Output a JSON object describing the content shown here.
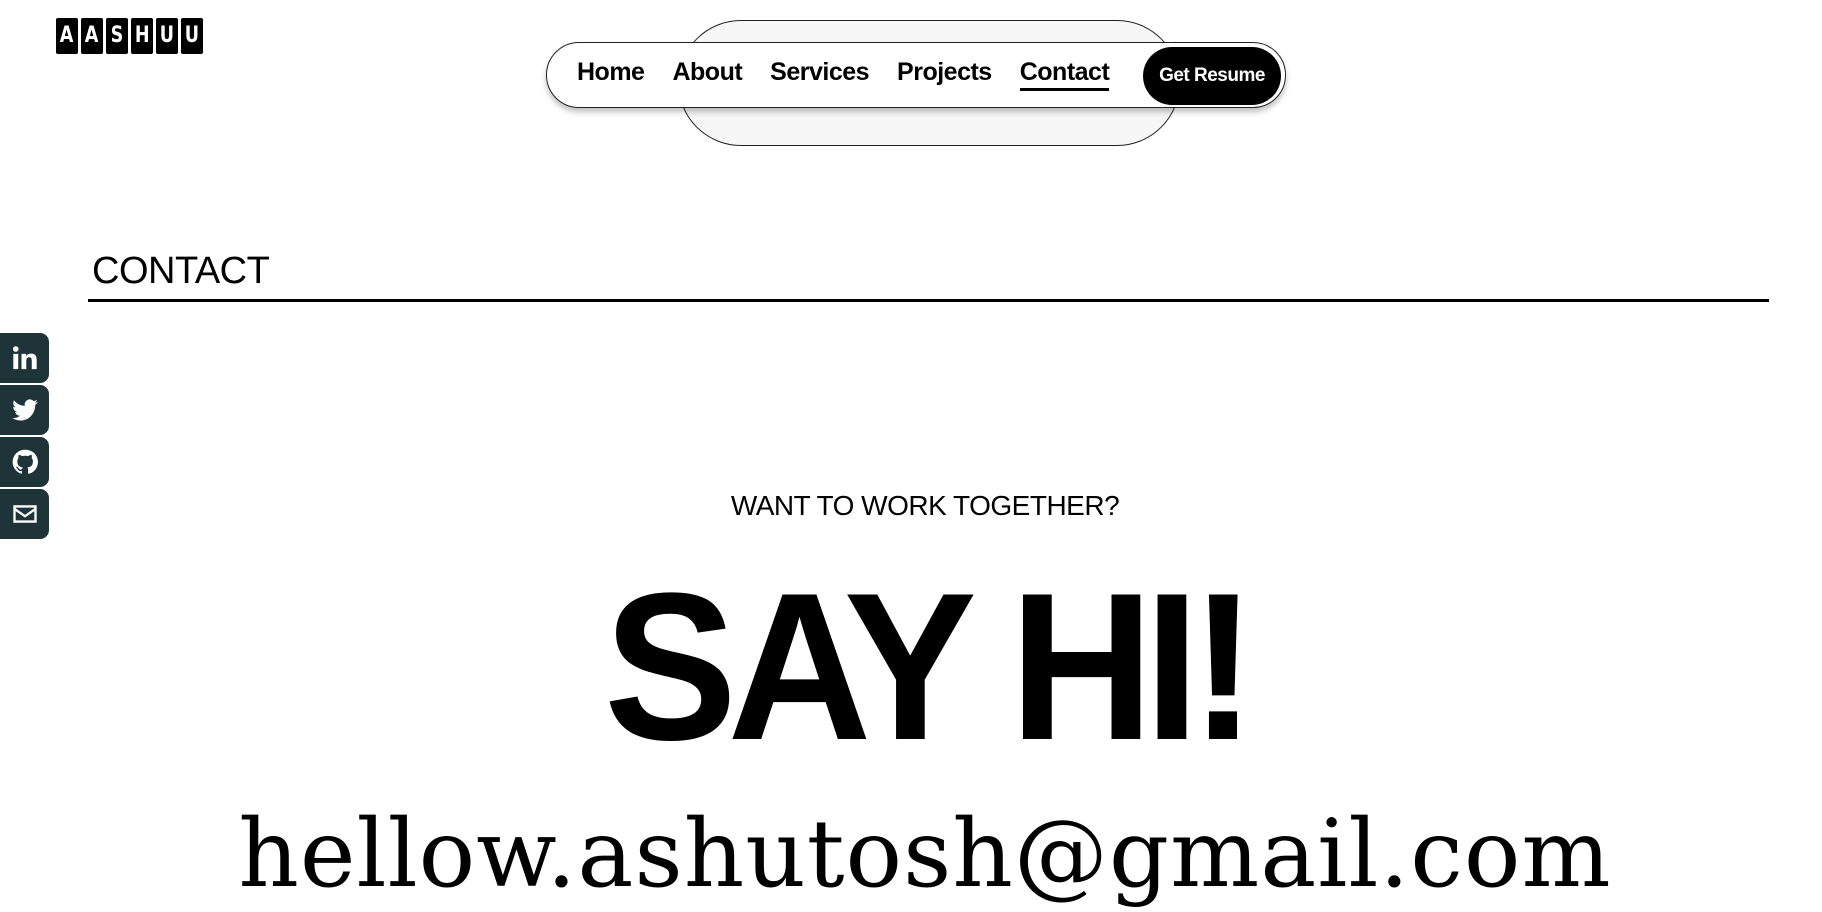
{
  "logo": {
    "letters": [
      "A",
      "A",
      "S",
      "H",
      "U",
      "U"
    ]
  },
  "nav": {
    "items": [
      {
        "label": "Home"
      },
      {
        "label": "About"
      },
      {
        "label": "Services"
      },
      {
        "label": "Projects"
      },
      {
        "label": "Contact",
        "active": true
      }
    ],
    "resume_label": "Get Resume"
  },
  "section": {
    "title": "CONTACT"
  },
  "social": [
    {
      "icon": "linkedin-icon"
    },
    {
      "icon": "twitter-icon"
    },
    {
      "icon": "github-icon"
    },
    {
      "icon": "mail-icon"
    }
  ],
  "hero": {
    "kicker": "WANT TO WORK TOGETHER?",
    "headline": "SAY HI!",
    "email": "hellow.ashutosh@gmail.com"
  },
  "colors": {
    "social_bg": "#1f3438",
    "accent": "#000000"
  }
}
